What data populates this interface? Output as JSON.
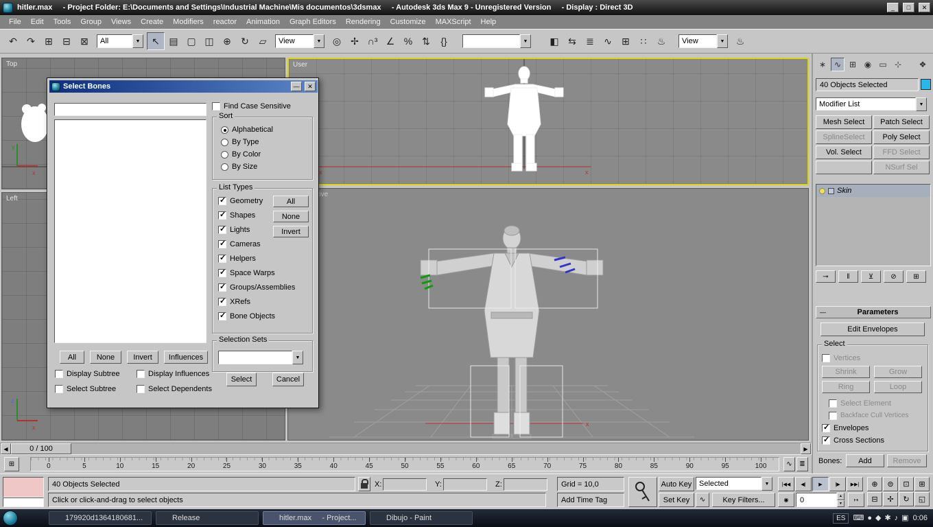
{
  "ui": {
    "chevron_down": "▼",
    "arrow_up": "▲",
    "arrow_down": "▼",
    "arrow_left": "◀",
    "arrow_right": "▶",
    "minimize": "—",
    "close": "✕"
  },
  "titlebar": {
    "title": "hitler.max     - Project Folder: E:\\Documents and Settings\\Industrial Machine\\Mis documentos\\3dsmax     - Autodesk 3ds Max 9 - Unregistered Version     - Display : Direct 3D",
    "min": "_",
    "max": "□",
    "close": "✕"
  },
  "menu": {
    "items": [
      "File",
      "Edit",
      "Tools",
      "Group",
      "Views",
      "Create",
      "Modifiers",
      "reactor",
      "Animation",
      "Graph Editors",
      "Rendering",
      "Customize",
      "MAXScript",
      "Help"
    ]
  },
  "toolbar": {
    "group1": [
      {
        "name": "undo-icon",
        "glyph": "↶"
      },
      {
        "name": "redo-icon",
        "glyph": "↷"
      },
      {
        "name": "select-and-link-icon",
        "glyph": "⊞"
      },
      {
        "name": "unlink-selection-icon",
        "glyph": "⊟"
      },
      {
        "name": "bind-to-space-warp-icon",
        "glyph": "⊠"
      }
    ],
    "selection_filter": "All",
    "group2": [
      {
        "name": "select-object-icon",
        "glyph": "↖",
        "pressed": true
      },
      {
        "name": "select-by-name-icon",
        "glyph": "▤"
      },
      {
        "name": "rectangular-selection-region-icon",
        "glyph": "▢"
      },
      {
        "name": "window-crossing-icon",
        "glyph": "◫"
      },
      {
        "name": "select-and-move-icon",
        "glyph": "⊕"
      },
      {
        "name": "select-and-rotate-icon",
        "glyph": "↻"
      },
      {
        "name": "select-and-scale-icon",
        "glyph": "▱"
      }
    ],
    "reference_coord": "View",
    "group4": [
      {
        "name": "use-pivot-center-icon",
        "glyph": "◎"
      },
      {
        "name": "select-and-manipulate-icon",
        "glyph": "✢"
      },
      {
        "name": "snaps-toggle-icon",
        "glyph": "∩³"
      },
      {
        "name": "angle-snap-icon",
        "glyph": "∠"
      },
      {
        "name": "percent-snap-icon",
        "glyph": "%"
      },
      {
        "name": "spinner-snap-icon",
        "glyph": "⇅"
      },
      {
        "name": "edit-named-selection-sets-icon",
        "glyph": "{}"
      }
    ],
    "named_selection": "",
    "group5": [
      {
        "name": "mirror-icon",
        "glyph": "◧"
      },
      {
        "name": "align-icon",
        "glyph": "⇆"
      },
      {
        "name": "layer-manager-icon",
        "glyph": "≣"
      },
      {
        "name": "curve-editor-icon",
        "glyph": "∿"
      },
      {
        "name": "schematic-view-icon",
        "glyph": "⊞"
      },
      {
        "name": "material-editor-icon",
        "glyph": "∷"
      },
      {
        "name": "render-setup-icon",
        "glyph": "♨"
      }
    ],
    "render_view": "View",
    "group6": [
      {
        "name": "quick-render-icon",
        "glyph": "♨"
      }
    ]
  },
  "viewports": {
    "top": "Top",
    "user": "User",
    "left": "Left",
    "perspective": "Perspective",
    "ax_x": "x",
    "ax_y": "y",
    "ax_z": "z"
  },
  "dialog": {
    "title": "Select Bones",
    "find_case_label": "Find Case Sensitive",
    "sort": {
      "title": "Sort",
      "options": [
        {
          "label": "Alphabetical",
          "selected": true
        },
        {
          "label": "By Type"
        },
        {
          "label": "By Color"
        },
        {
          "label": "By Size"
        }
      ]
    },
    "list_types": {
      "title": "List Types",
      "items": [
        {
          "label": "Geometry",
          "checked": true
        },
        {
          "label": "Shapes",
          "checked": true
        },
        {
          "label": "Lights",
          "checked": true
        },
        {
          "label": "Cameras",
          "checked": true
        },
        {
          "label": "Helpers",
          "checked": true
        },
        {
          "label": "Space Warps",
          "checked": true
        },
        {
          "label": "Groups/Assemblies",
          "checked": true
        },
        {
          "label": "XRefs",
          "checked": true
        },
        {
          "label": "Bone Objects",
          "checked": true
        }
      ],
      "buttons": [
        "All",
        "None",
        "Invert"
      ]
    },
    "selection_sets": {
      "title": "Selection Sets",
      "value": ""
    },
    "bottom_buttons": [
      "All",
      "None",
      "Invert",
      "Influences"
    ],
    "options": [
      {
        "label": "Display Subtree"
      },
      {
        "label": "Display Influences"
      },
      {
        "label": "Select Subtree"
      },
      {
        "label": "Select Dependents"
      }
    ],
    "select_label": "Select",
    "cancel_label": "Cancel"
  },
  "command_panel": {
    "tabs": [
      {
        "name": "create-tab-icon",
        "glyph": "∗"
      },
      {
        "name": "modify-tab-icon",
        "glyph": "∿",
        "pressed": true
      },
      {
        "name": "hierarchy-tab-icon",
        "glyph": "⊞"
      },
      {
        "name": "motion-tab-icon",
        "glyph": "◉"
      },
      {
        "name": "display-tab-icon",
        "glyph": "▭"
      },
      {
        "name": "utilities-tab-icon",
        "glyph": "⊹"
      }
    ],
    "object_info": "40 Objects Selected",
    "modifier_list_label": "Modifier List",
    "modifier_buttons": [
      {
        "label": "Mesh Select"
      },
      {
        "label": "Patch Select"
      },
      {
        "label": "SplineSelect",
        "disabled": true
      },
      {
        "label": "Poly Select"
      },
      {
        "label": "Vol. Select"
      },
      {
        "label": "FFD Select",
        "disabled": true
      },
      {
        "label": "",
        "blank": true
      },
      {
        "label": "NSurf Sel",
        "disabled": true
      }
    ],
    "stack_item": "Skin",
    "stack_tools": [
      {
        "name": "pin-stack-icon",
        "glyph": "⊸"
      },
      {
        "name": "show-end-result-icon",
        "glyph": "‖"
      },
      {
        "name": "make-unique-icon",
        "glyph": "⊻"
      },
      {
        "name": "remove-modifier-icon",
        "glyph": "⊘"
      },
      {
        "name": "configure-modifier-sets-icon",
        "glyph": "⊞"
      }
    ],
    "parameters_title": "Parameters",
    "edit_envelopes_label": "Edit Envelopes",
    "select_group": {
      "title": "Select",
      "vertices_label": "Vertices",
      "shrink_label": "Shrink",
      "grow_label": "Grow",
      "ring_label": "Ring",
      "loop_label": "Loop",
      "select_element_label": "Select Element",
      "backface_label": "Backface Cull Vertices",
      "envelopes_label": "Envelopes",
      "cross_sections_label": "Cross Sections"
    },
    "bones_label": "Bones:",
    "add_label": "Add",
    "remove_label": "Remove"
  },
  "timeline": {
    "slider": "0 / 100",
    "ticks": [
      "0",
      "5",
      "10",
      "15",
      "20",
      "25",
      "30",
      "35",
      "40",
      "45",
      "50",
      "55",
      "60",
      "65",
      "70",
      "75",
      "80",
      "85",
      "90",
      "95",
      "100"
    ]
  },
  "status": {
    "selection_status": "40 Objects Selected",
    "prompt": "Click or click-and-drag to select objects",
    "grid_label": "Grid = 10,0",
    "time_tag_label": "Add Time Tag",
    "x_label": "X:",
    "y_label": "Y:",
    "z_label": "Z:",
    "auto_key_label": "Auto Key",
    "set_key_label": "Set Key",
    "key_mode_label": "Selected",
    "key_filters_label": "Key Filters...",
    "frame_value": "0",
    "transport": [
      {
        "name": "go-to-start-button",
        "glyph": "|◀◀"
      },
      {
        "name": "previous-frame-button",
        "glyph": "◀|"
      },
      {
        "name": "play-button",
        "glyph": "▶",
        "pressed": true
      },
      {
        "name": "next-frame-button",
        "glyph": "|▶"
      },
      {
        "name": "go-to-end-button",
        "glyph": "▶▶|"
      }
    ],
    "nav_icons": [
      {
        "name": "zoom-icon",
        "glyph": "⊕"
      },
      {
        "name": "zoom-all-icon",
        "glyph": "⊜"
      },
      {
        "name": "zoom-extents-icon",
        "glyph": "⊡"
      },
      {
        "name": "zoom-extents-all-icon",
        "glyph": "⊞"
      },
      {
        "name": "field-of-view-icon",
        "glyph": "⊟"
      },
      {
        "name": "pan-icon",
        "glyph": "✢"
      },
      {
        "name": "arc-rotate-icon",
        "glyph": "↻"
      },
      {
        "name": "maximize-viewport-icon",
        "glyph": "◱"
      }
    ]
  },
  "taskbar": {
    "buttons": [
      {
        "label": "179920d1364180681...",
        "cls": "tb-ico-image"
      },
      {
        "label": "Release",
        "cls": "tb-ico-folder"
      },
      {
        "label": "hitler.max     - Project...",
        "cls": "tb-ico-max",
        "active": true
      },
      {
        "label": "Dibujo - Paint",
        "cls": "tb-ico-paint"
      }
    ],
    "tray_icons": [
      {
        "name": "keyboard-icon",
        "glyph": "⌨",
        "cls": "c-light"
      },
      {
        "name": "antivirus-icon",
        "glyph": "●",
        "cls": "c-green"
      },
      {
        "name": "messenger-icon",
        "glyph": "◆",
        "cls": "c-blue"
      },
      {
        "name": "update-icon",
        "glyph": "✱",
        "cls": "c-red"
      },
      {
        "name": "volume-icon",
        "glyph": "♪",
        "cls": "c-light"
      },
      {
        "name": "network-icon",
        "glyph": "▣",
        "cls": "c-light"
      }
    ],
    "language": "ES",
    "clock": "0:06"
  }
}
